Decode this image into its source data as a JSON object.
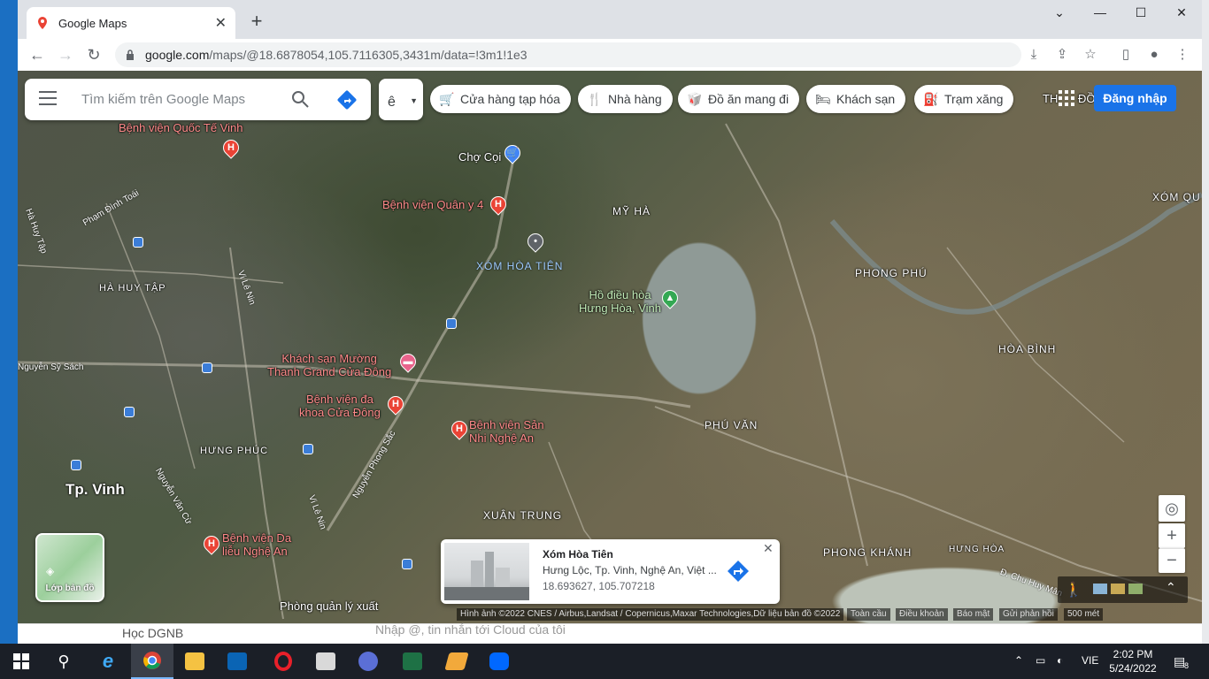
{
  "browser": {
    "tab_title": "Google Maps",
    "url_host": "google.com",
    "url_path": "/maps/@18.6878054,105.7116305,3431m/data=!3m1!1e3"
  },
  "maps": {
    "search_placeholder": "Tìm kiếm trên Google Maps",
    "lang_label": "ê",
    "chips": [
      {
        "label": "Cửa hàng tạp hóa",
        "icon": "cart-icon"
      },
      {
        "label": "Nhà hàng",
        "icon": "restaurant-icon"
      },
      {
        "label": "Đồ ăn mang đi",
        "icon": "takeout-icon"
      },
      {
        "label": "Khách sạn",
        "icon": "hotel-icon"
      },
      {
        "label": "Trạm xăng",
        "icon": "gas-station-icon"
      }
    ],
    "partial_label": "TH",
    "partial_label2": "ĐỒ",
    "signin_label": "Đăng nhập",
    "layers_label": "Lớp bản đồ",
    "area_labels": [
      "MỸ HÀ",
      "HÀ HUY TẬP",
      "PHONG PHÚ",
      "HÒA BÌNH",
      "PHÚ VĂN",
      "HƯNG PHÚC",
      "XUÂN TRUNG",
      "PHONG KHÁNH",
      "HƯNG HÒA",
      "XÓM QU"
    ],
    "city_label": "Tp. Vinh",
    "selected_place_label": "XÓM HÒA TIÊN",
    "poi_labels": {
      "hospital_quocte": "Bệnh viện Quốc Tế Vinh",
      "cho_coi": "Chợ Cọi",
      "hospital_quany": "Bệnh viện Quân y 4",
      "lake": "Hồ điều hòa\nHưng Hòa, Vinh",
      "hotel_muong_thanh": "Khách sạn Mường\nThanh Grand Cửa Đông",
      "hospital_cuadong": "Bệnh viện đa\nkhoa Cửa Đông",
      "hospital_sannhi": "Bệnh viện Sản\nNhi Nghệ An",
      "hospital_dalieu": "Bệnh viện Da\nliễu Nghệ An",
      "phong_quan_ly": "Phòng quản lý xuất"
    },
    "street_labels": [
      "Phạm Đình Toái",
      "Hà Huy Tập",
      "Nguyễn Sỹ Sách",
      "Vi Lê Nin",
      "Nguyễn Phong Sắc",
      "Nguyễn Văn Cừ",
      "Vi Lê Nin",
      "Đ. Chu Huy Mân",
      "Lê Nin"
    ],
    "card": {
      "name": "Xóm Hòa Tiên",
      "address": "Hưng Lộc, Tp. Vinh, Nghệ An, Việt ...",
      "coords": "18.693627, 105.707218"
    },
    "attribution": "Hình ảnh ©2022 CNES / Airbus,Landsat / Copernicus,Maxar Technologies,Dữ liệu bản đồ ©2022",
    "links": [
      "Toàn cầu",
      "Điều khoản",
      "Báo mật",
      "Gửi phản hồi"
    ],
    "scale": "500 mét"
  },
  "behind": {
    "left_text": "Học DGNB",
    "chat_placeholder": "Nhập @, tin nhắn tới Cloud của tôi"
  },
  "taskbar": {
    "lang": "VIE",
    "time": "2:02 PM",
    "date": "5/24/2022",
    "notif": "8"
  }
}
